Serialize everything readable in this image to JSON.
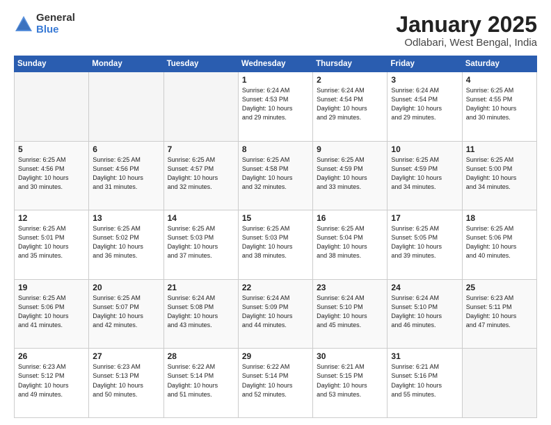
{
  "header": {
    "logo_general": "General",
    "logo_blue": "Blue",
    "month_title": "January 2025",
    "location": "Odlabari, West Bengal, India"
  },
  "days_of_week": [
    "Sunday",
    "Monday",
    "Tuesday",
    "Wednesday",
    "Thursday",
    "Friday",
    "Saturday"
  ],
  "weeks": [
    [
      {
        "day": "",
        "info": ""
      },
      {
        "day": "",
        "info": ""
      },
      {
        "day": "",
        "info": ""
      },
      {
        "day": "1",
        "info": "Sunrise: 6:24 AM\nSunset: 4:53 PM\nDaylight: 10 hours\nand 29 minutes."
      },
      {
        "day": "2",
        "info": "Sunrise: 6:24 AM\nSunset: 4:54 PM\nDaylight: 10 hours\nand 29 minutes."
      },
      {
        "day": "3",
        "info": "Sunrise: 6:24 AM\nSunset: 4:54 PM\nDaylight: 10 hours\nand 29 minutes."
      },
      {
        "day": "4",
        "info": "Sunrise: 6:25 AM\nSunset: 4:55 PM\nDaylight: 10 hours\nand 30 minutes."
      }
    ],
    [
      {
        "day": "5",
        "info": "Sunrise: 6:25 AM\nSunset: 4:56 PM\nDaylight: 10 hours\nand 30 minutes."
      },
      {
        "day": "6",
        "info": "Sunrise: 6:25 AM\nSunset: 4:56 PM\nDaylight: 10 hours\nand 31 minutes."
      },
      {
        "day": "7",
        "info": "Sunrise: 6:25 AM\nSunset: 4:57 PM\nDaylight: 10 hours\nand 32 minutes."
      },
      {
        "day": "8",
        "info": "Sunrise: 6:25 AM\nSunset: 4:58 PM\nDaylight: 10 hours\nand 32 minutes."
      },
      {
        "day": "9",
        "info": "Sunrise: 6:25 AM\nSunset: 4:59 PM\nDaylight: 10 hours\nand 33 minutes."
      },
      {
        "day": "10",
        "info": "Sunrise: 6:25 AM\nSunset: 4:59 PM\nDaylight: 10 hours\nand 34 minutes."
      },
      {
        "day": "11",
        "info": "Sunrise: 6:25 AM\nSunset: 5:00 PM\nDaylight: 10 hours\nand 34 minutes."
      }
    ],
    [
      {
        "day": "12",
        "info": "Sunrise: 6:25 AM\nSunset: 5:01 PM\nDaylight: 10 hours\nand 35 minutes."
      },
      {
        "day": "13",
        "info": "Sunrise: 6:25 AM\nSunset: 5:02 PM\nDaylight: 10 hours\nand 36 minutes."
      },
      {
        "day": "14",
        "info": "Sunrise: 6:25 AM\nSunset: 5:03 PM\nDaylight: 10 hours\nand 37 minutes."
      },
      {
        "day": "15",
        "info": "Sunrise: 6:25 AM\nSunset: 5:03 PM\nDaylight: 10 hours\nand 38 minutes."
      },
      {
        "day": "16",
        "info": "Sunrise: 6:25 AM\nSunset: 5:04 PM\nDaylight: 10 hours\nand 38 minutes."
      },
      {
        "day": "17",
        "info": "Sunrise: 6:25 AM\nSunset: 5:05 PM\nDaylight: 10 hours\nand 39 minutes."
      },
      {
        "day": "18",
        "info": "Sunrise: 6:25 AM\nSunset: 5:06 PM\nDaylight: 10 hours\nand 40 minutes."
      }
    ],
    [
      {
        "day": "19",
        "info": "Sunrise: 6:25 AM\nSunset: 5:06 PM\nDaylight: 10 hours\nand 41 minutes."
      },
      {
        "day": "20",
        "info": "Sunrise: 6:25 AM\nSunset: 5:07 PM\nDaylight: 10 hours\nand 42 minutes."
      },
      {
        "day": "21",
        "info": "Sunrise: 6:24 AM\nSunset: 5:08 PM\nDaylight: 10 hours\nand 43 minutes."
      },
      {
        "day": "22",
        "info": "Sunrise: 6:24 AM\nSunset: 5:09 PM\nDaylight: 10 hours\nand 44 minutes."
      },
      {
        "day": "23",
        "info": "Sunrise: 6:24 AM\nSunset: 5:10 PM\nDaylight: 10 hours\nand 45 minutes."
      },
      {
        "day": "24",
        "info": "Sunrise: 6:24 AM\nSunset: 5:10 PM\nDaylight: 10 hours\nand 46 minutes."
      },
      {
        "day": "25",
        "info": "Sunrise: 6:23 AM\nSunset: 5:11 PM\nDaylight: 10 hours\nand 47 minutes."
      }
    ],
    [
      {
        "day": "26",
        "info": "Sunrise: 6:23 AM\nSunset: 5:12 PM\nDaylight: 10 hours\nand 49 minutes."
      },
      {
        "day": "27",
        "info": "Sunrise: 6:23 AM\nSunset: 5:13 PM\nDaylight: 10 hours\nand 50 minutes."
      },
      {
        "day": "28",
        "info": "Sunrise: 6:22 AM\nSunset: 5:14 PM\nDaylight: 10 hours\nand 51 minutes."
      },
      {
        "day": "29",
        "info": "Sunrise: 6:22 AM\nSunset: 5:14 PM\nDaylight: 10 hours\nand 52 minutes."
      },
      {
        "day": "30",
        "info": "Sunrise: 6:21 AM\nSunset: 5:15 PM\nDaylight: 10 hours\nand 53 minutes."
      },
      {
        "day": "31",
        "info": "Sunrise: 6:21 AM\nSunset: 5:16 PM\nDaylight: 10 hours\nand 55 minutes."
      },
      {
        "day": "",
        "info": ""
      }
    ]
  ]
}
